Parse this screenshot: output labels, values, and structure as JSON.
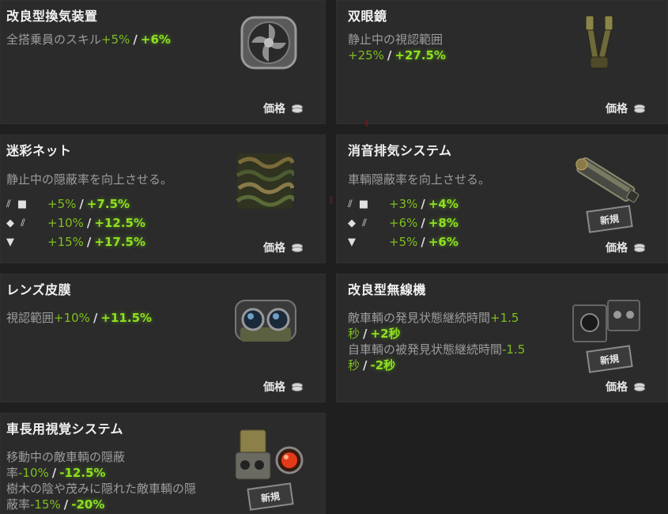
{
  "price_label": "価格",
  "new_label": "新規",
  "cards": [
    {
      "title": "改良型換気装置",
      "desc_prefix": "全搭乗員のスキル",
      "base": "+5%",
      "slash": "/",
      "boost": "+6%",
      "icon": "ventilation-fan-icon"
    },
    {
      "title": "双眼鏡",
      "desc_prefix": "静止中の視認範囲",
      "base": "+25%",
      "slash": "/",
      "boost": "+27.5%",
      "icon": "binocular-periscope-icon"
    },
    {
      "title": "迷彩ネット",
      "desc": "静止中の隠蔽率を向上させる。",
      "rows": [
        {
          "icons": "⫽ ■",
          "base": "+5%",
          "slash": "/",
          "boost": "+7.5%"
        },
        {
          "icons": "◆ ⫽",
          "base": "+10%",
          "slash": "/",
          "boost": "+12.5%"
        },
        {
          "icons": "▼",
          "base": "+15%",
          "slash": "/",
          "boost": "+17.5%"
        }
      ],
      "icon": "camouflage-net-icon"
    },
    {
      "title": "消音排気システム",
      "desc": "車輌隠蔽率を向上させる。",
      "rows": [
        {
          "icons": "⫽ ■",
          "base": "+3%",
          "slash": "/",
          "boost": "+4%"
        },
        {
          "icons": "◆ ⫽",
          "base": "+6%",
          "slash": "/",
          "boost": "+8%"
        },
        {
          "icons": "▼",
          "base": "+5%",
          "slash": "/",
          "boost": "+6%"
        }
      ],
      "icon": "exhaust-muffler-icon"
    },
    {
      "title": "レンズ皮膜",
      "desc_prefix": "視認範囲",
      "base": "+10%",
      "slash": "/",
      "boost": "+11.5%",
      "icon": "lens-coating-icon"
    },
    {
      "title": "改良型無線機",
      "line1_prefix": "敵車輌の発見状態継続時間",
      "line1_base_a": "+1.5",
      "line1_base_b": "秒",
      "line1_slash": "/",
      "line1_boost": "+2秒",
      "line2_prefix": "自車輌の被発見状態継続時間",
      "line2_base_a": "-1.5",
      "line2_base_b": "秒",
      "line2_slash": "/",
      "line2_boost": "-2秒",
      "icon": "radio-set-icon"
    },
    {
      "title": "車長用視覚システム",
      "line1_a": "移動中の敵車輌の隠蔽",
      "line1_b": "率",
      "line1_base": "-10%",
      "line1_slash": "/",
      "line1_boost": "-12.5%",
      "line2_a": "樹木の陰や茂みに隠れた敵車輌の隠",
      "line2_b": "蔽率",
      "line2_base": "-15%",
      "line2_slash": "/",
      "line2_boost": "-20%",
      "icon": "commander-vision-system-icon"
    }
  ]
}
